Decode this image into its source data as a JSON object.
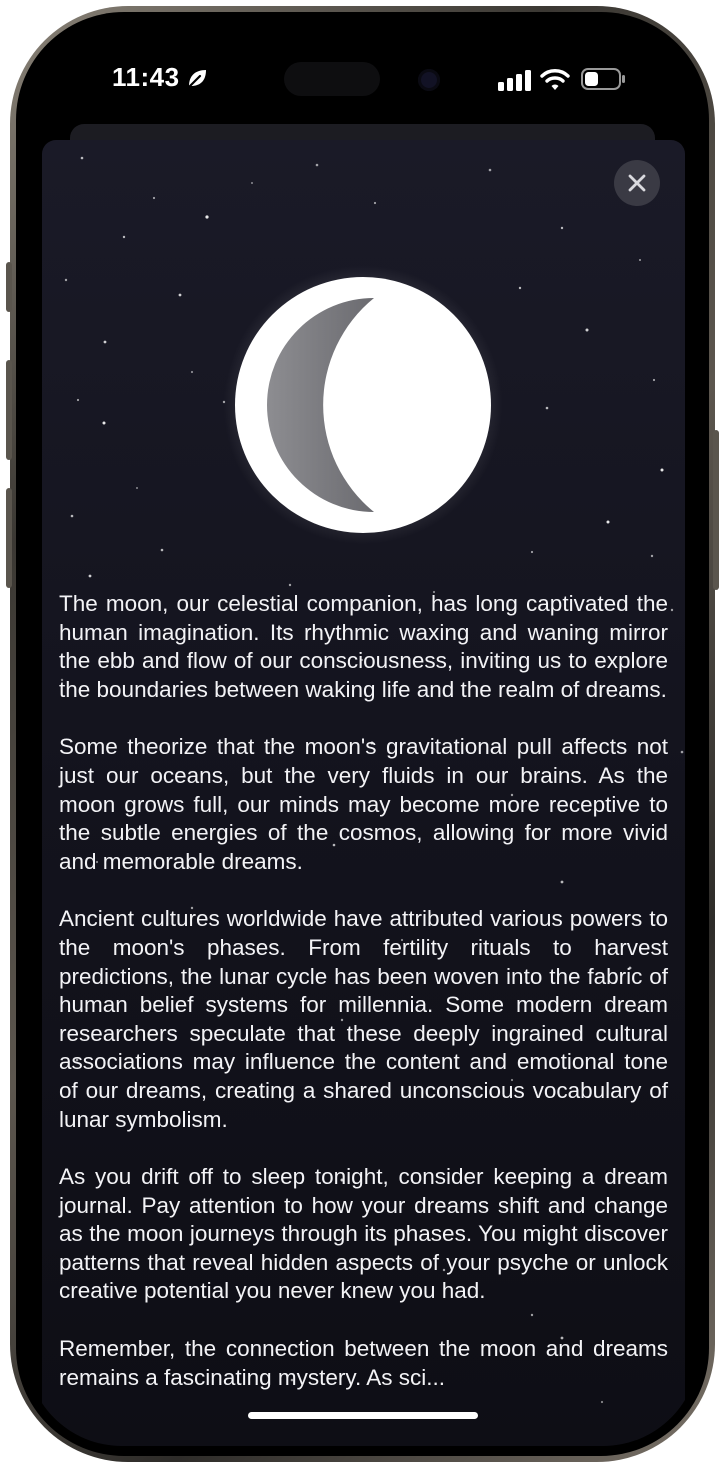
{
  "status_bar": {
    "time": "11:43",
    "icons": [
      "leaf-icon",
      "cellular-signal-icon",
      "wifi-icon",
      "battery-icon"
    ]
  },
  "sheet": {
    "close_icon": "close-icon",
    "moon_icon": "crescent-moon-icon",
    "paragraphs": [
      "The moon, our celestial companion, has long captivated the human imagination. Its rhythmic waxing and waning mirror the ebb and flow of our consciousness, inviting us to explore the boundaries between waking life and the realm of dreams.",
      "Some theorize that the moon's gravitational pull affects not just our oceans, but the very fluids in our brains. As the moon grows full, our minds may become more receptive to the subtle energies of the cosmos, allowing for more vivid and memorable dreams.",
      "Ancient cultures worldwide have attributed various powers to the moon's phases. From fertility rituals to harvest predictions, the lunar cycle has been woven into the fabric of human belief systems for millennia. Some modern dream researchers speculate that these deeply ingrained cultural associations may influence the content and emotional tone of our dreams, creating a shared unconscious vocabulary of lunar symbolism.",
      "As you drift off to sleep tonight, consider keeping a dream journal. Pay attention to how your dreams shift and change as the moon journeys through its phases. You might discover patterns that reveal hidden aspects of your psyche or unlock creative potential you never knew you had.",
      "Remember, the connection between the moon and dreams remains a fascinating mystery. As sci..."
    ]
  },
  "colors": {
    "background": "#13131d",
    "text": "#f3f3f6",
    "moon": "#ffffff",
    "crescent_shadow": "#7c7c80"
  }
}
